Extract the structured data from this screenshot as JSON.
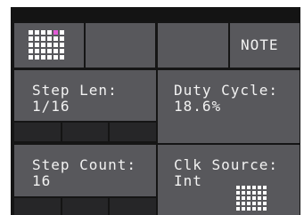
{
  "top_row": {
    "note_button_label": "NOTE"
  },
  "params": {
    "step_len": {
      "label": "Step Len:",
      "value": "1/16"
    },
    "duty_cycle": {
      "label": "Duty Cycle:",
      "value": "18.6%"
    },
    "step_count": {
      "label": "Step Count:",
      "value": "16"
    },
    "clk_source": {
      "label": "Clk Source:",
      "value": "Int"
    }
  },
  "colors": {
    "background": "#151515",
    "cell": "#58585c",
    "text": "#f2f2f2",
    "active_step": "#e35bd6"
  },
  "icons": {
    "step_grid": "step-grid-icon",
    "clock_grid": "clock-grid-icon"
  }
}
